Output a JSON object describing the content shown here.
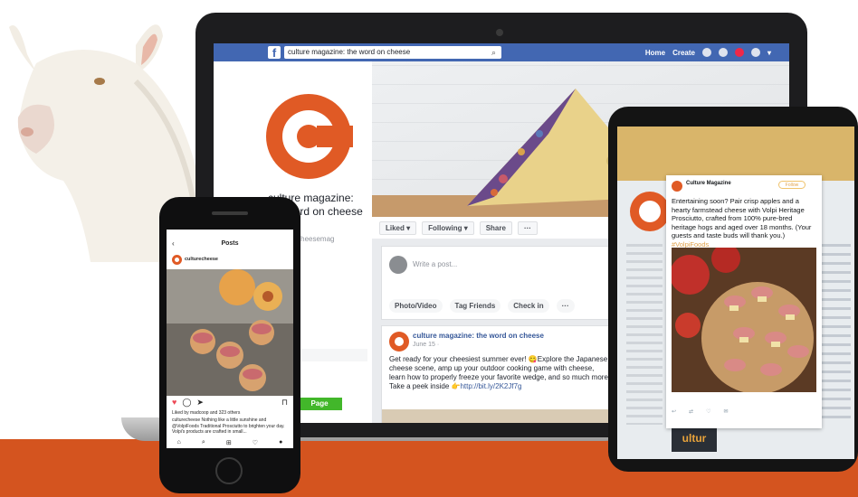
{
  "facebook": {
    "search_value": "culture magazine: the word on cheese",
    "nav": [
      "Home",
      "Create"
    ],
    "page_name": "culture magazine: the word on cheese",
    "page_handle": "@culturecheesemag",
    "action_buttons": [
      "Liked ▾",
      "Following ▾",
      "Share",
      "···"
    ],
    "composer_prompt": "Write a post...",
    "composer_options": [
      "Photo/Video",
      "Tag Friends",
      "Check in",
      "···"
    ],
    "post_author": "culture magazine: the word on cheese",
    "post_date": "June 15 · ",
    "post_text": "Get ready for your cheesiest summer ever! 😋Explore the Japanese cheese scene, amp up your outdoor cooking game with cheese, learn how to properly freeze your favorite wedge, and so much more! Take a peek inside 👉",
    "post_link": "http://bit.ly/2K2Jf7g",
    "page_button": "Page"
  },
  "twitter": {
    "account": "Culture Magazine",
    "follow": "Follow",
    "tweet_text": "Entertaining soon? Pair crisp apples and a hearty farmstead cheese with Volpi Heritage Prosciutto, crafted from 100% pure-bred heritage hogs and aged over 18 months. (Your guests and taste buds will thank you.)",
    "hashtag": "#VolpiFoods",
    "footer_logo": "ultur"
  },
  "instagram": {
    "title": "Posts",
    "user": "culturecheese",
    "likes": "Liked by madcoop and 323 others",
    "caption": "culturecheese Nothing like a little sunshine and @VolpiFoods Traditional Prosciutto to brighten your day. Volpi's products are crafted in small..."
  },
  "colors": {
    "brand_orange": "#d4541f",
    "facebook_blue": "#4267b2"
  }
}
